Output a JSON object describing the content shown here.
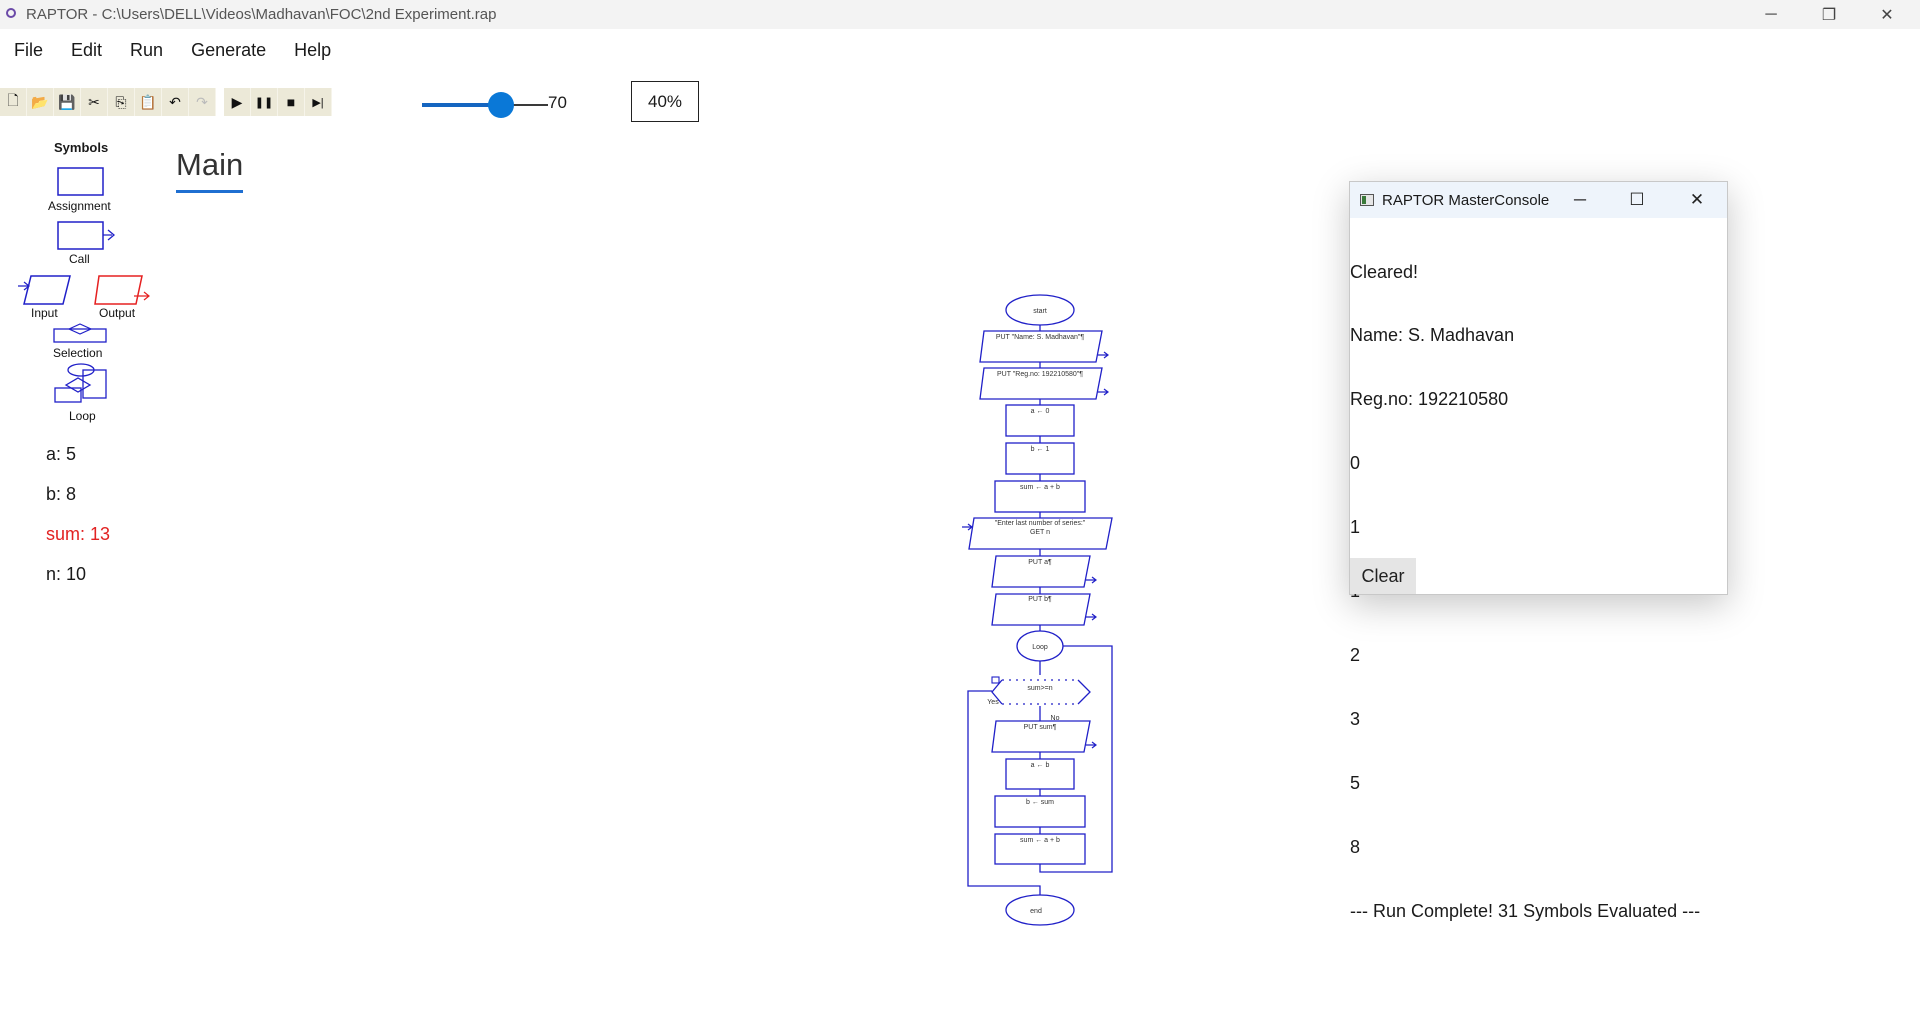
{
  "window": {
    "title": "RAPTOR - C:\\Users\\DELL\\Videos\\Madhavan\\FOC\\2nd Experiment.rap",
    "controls": {
      "minimize": "─",
      "restore": "❐",
      "close": "✕"
    }
  },
  "menu": [
    "File",
    "Edit",
    "Run",
    "Generate",
    "Help"
  ],
  "toolbar": {
    "buttons": [
      {
        "name": "new-file-icon",
        "glyph": "🗋"
      },
      {
        "name": "open-folder-icon",
        "glyph": "📂"
      },
      {
        "name": "save-icon",
        "glyph": "💾"
      },
      {
        "name": "cut-icon",
        "glyph": "✂"
      },
      {
        "name": "copy-icon",
        "glyph": "⎘"
      },
      {
        "name": "paste-icon",
        "glyph": "📋"
      },
      {
        "name": "undo-icon",
        "glyph": "↶"
      },
      {
        "name": "redo-icon",
        "glyph": "↷"
      },
      {
        "name": "run-icon",
        "glyph": "▶"
      },
      {
        "name": "pause-icon",
        "glyph": "❚❚"
      },
      {
        "name": "stop-icon",
        "glyph": "■"
      },
      {
        "name": "step-icon",
        "glyph": "▶|"
      }
    ],
    "speed_value": 70,
    "speed_max": 100,
    "zoom": "40%"
  },
  "symbols": {
    "title": "Symbols",
    "items": [
      "Assignment",
      "Call",
      "Input",
      "Output",
      "Selection",
      "Loop"
    ]
  },
  "variables": [
    {
      "text": "a: 5",
      "changed": false
    },
    {
      "text": "b: 8",
      "changed": false
    },
    {
      "text": "sum: 13",
      "changed": true
    },
    {
      "text": "n: 10",
      "changed": false
    }
  ],
  "tab": {
    "label": "Main"
  },
  "flowchart": {
    "start": "start",
    "out_name": "PUT \"Name: S. Madhavan\"¶",
    "out_reg": "PUT \"Reg.no: 192210580\"¶",
    "assign_a": "a ← 0",
    "assign_b": "b ← 1",
    "assign_sum": "sum ← a + b",
    "input_prompt": "\"Enter last number of series:\"",
    "input_var": "GET n",
    "out_a": "PUT a¶",
    "out_b": "PUT b¶",
    "loop": "Loop",
    "condition": "sum>=n",
    "yes": "Yes",
    "no": "No",
    "out_sum": "PUT sum¶",
    "loop_a": "a ← b",
    "loop_b": "b ← sum",
    "loop_sum": "sum ← a + b",
    "end": "end",
    "accent_color": "#2020c8"
  },
  "console": {
    "title": "RAPTOR MasterConsole",
    "lines": [
      "Cleared!",
      "Name: S. Madhavan",
      "Reg.no: 192210580",
      "0",
      "1",
      "1",
      "2",
      "3",
      "5",
      "8",
      "--- Run Complete! 31 Symbols Evaluated ---"
    ],
    "clear_label": "Clear",
    "controls": {
      "minimize": "─",
      "maximize": "☐",
      "close": "✕"
    }
  }
}
